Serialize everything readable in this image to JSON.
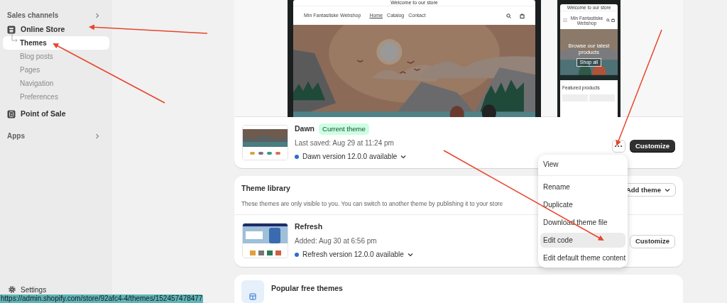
{
  "sidebar": {
    "items": [
      {
        "kind": "header",
        "label": "Sales channels"
      },
      {
        "kind": "channel",
        "label": "Online Store",
        "children": [
          {
            "label": "Themes",
            "selected": true
          },
          {
            "label": "Blog posts",
            "selected": false
          },
          {
            "label": "Pages",
            "selected": false
          },
          {
            "label": "Navigation",
            "selected": false
          },
          {
            "label": "Preferences",
            "selected": false
          }
        ]
      },
      {
        "kind": "channel",
        "label": "Point of Sale"
      },
      {
        "kind": "header",
        "label": "Apps"
      }
    ],
    "settings": "Settings"
  },
  "current_theme": {
    "preview": {
      "desktop": {
        "announcement": "Welcome to our store",
        "store_name": "Min Fantastiske Webshop",
        "nav": [
          {
            "label": "Home",
            "selected": true
          },
          {
            "label": "Catalog",
            "selected": false
          },
          {
            "label": "Contact",
            "selected": false
          }
        ]
      },
      "mobile": {
        "announcement": "Welcome to our store",
        "store_name": "Min Fantastiske Webshop",
        "hero_heading": "Browse our latest products",
        "hero_button": "Shop all",
        "section_title": "Featured products"
      }
    },
    "name": "Dawn",
    "badge": "Current theme",
    "saved": "Last saved: Aug 29 at 11:24 pm",
    "version": "Dawn version 12.0.0 available",
    "customize": "Customize"
  },
  "actions_menu": {
    "groups": [
      [
        {
          "label": "View",
          "selected": false
        }
      ],
      [
        {
          "label": "Rename",
          "selected": false
        },
        {
          "label": "Duplicate",
          "selected": false
        },
        {
          "label": "Download theme file",
          "selected": false
        },
        {
          "label": "Edit code",
          "selected": true
        },
        {
          "label": "Edit default theme content",
          "selected": false
        }
      ]
    ]
  },
  "theme_library": {
    "title": "Theme library",
    "description": "These themes are only visible to you. You can switch to another theme by publishing it to your store",
    "add_button": "Add theme",
    "themes": [
      {
        "name": "Refresh",
        "added": "Added: Aug 30 at 6:56 pm",
        "version": "Refresh version 12.0.0 available",
        "customize": "Customize"
      }
    ]
  },
  "popular": {
    "title": "Popular free themes"
  },
  "status_url": "https://admin.shopify.com/store/92afc4-4/themes/152457478477"
}
